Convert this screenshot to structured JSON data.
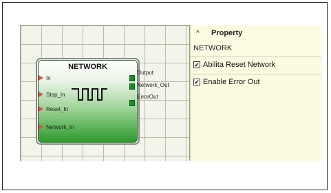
{
  "block": {
    "title": "NETWORK",
    "inputs": [
      "In",
      "Stop_In",
      "Reset_In",
      "Network_In"
    ],
    "outputs": [
      "Output",
      "Network_Out",
      "ErrorOut"
    ]
  },
  "properties": {
    "collapse_icon": "caret-up-icon",
    "header": "Property",
    "selected_component": "NETWORK",
    "options": [
      {
        "label": "Abilita Reset Network",
        "checked": true,
        "check_glyph": "✔"
      },
      {
        "label": "Enable Error Out",
        "checked": true,
        "check_glyph": "✔"
      }
    ]
  }
}
